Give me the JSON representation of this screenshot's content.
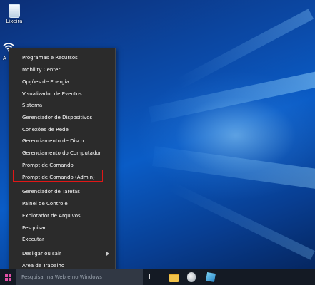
{
  "desktop": {
    "icons": [
      {
        "label": "Lixeira",
        "icon": "recycle-bin-icon"
      },
      {
        "label": "A",
        "icon": "network-icon"
      }
    ]
  },
  "context_menu": {
    "items": [
      {
        "label": "Programas e Recursos"
      },
      {
        "label": "Mobility Center"
      },
      {
        "label": "Opções de Energia"
      },
      {
        "label": "Visualizador de Eventos"
      },
      {
        "label": "Sistema"
      },
      {
        "label": "Gerenciador de Dispositivos"
      },
      {
        "label": "Conexões de Rede"
      },
      {
        "label": "Gerenciamento de Disco"
      },
      {
        "label": "Gerenciamento do Computador"
      },
      {
        "label": "Prompt de Comando"
      },
      {
        "label": "Prompt de Comando (Admin)",
        "highlighted": true
      },
      {
        "label": "Gerenciador de Tarefas"
      },
      {
        "label": "Painel de Controle"
      },
      {
        "label": "Explorador de Arquivos"
      },
      {
        "label": "Pesquisar"
      },
      {
        "label": "Executar"
      },
      {
        "label": "Desligar ou sair",
        "submenu": true
      },
      {
        "label": "Área de Trabalho"
      }
    ],
    "highlight_color": "#e01717"
  },
  "taskbar": {
    "search_placeholder": "Pesquisar na Web e no Windows",
    "start_color": "#e14fa7",
    "pinned": [
      "task-view-icon",
      "file-explorer-icon",
      "recycle-bin-icon",
      "app-icon"
    ]
  }
}
